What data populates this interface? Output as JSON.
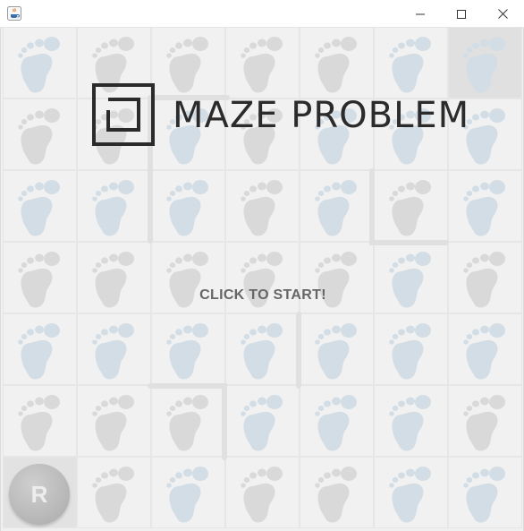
{
  "window": {
    "title": "",
    "app_icon": "java-cup-icon",
    "controls": {
      "minimize_icon": "minimize-icon",
      "maximize_icon": "maximize-icon",
      "close_icon": "close-icon"
    }
  },
  "game": {
    "logo_text": "MAZE PROBLEM",
    "start_prompt": "CLICK TO START!",
    "robot_label": "R",
    "grid": {
      "rows": 7,
      "cols": 7
    },
    "tile_icon": "footprint-icon",
    "colors": {
      "footprint_blue": "#d2dde5",
      "footprint_gray": "#d9d9d9",
      "tile_background": "#f1f1f1",
      "wall": "#e0e0e0",
      "robot": "#bdbdbd",
      "logo": "#2b2b2b",
      "prompt": "#666666"
    }
  }
}
